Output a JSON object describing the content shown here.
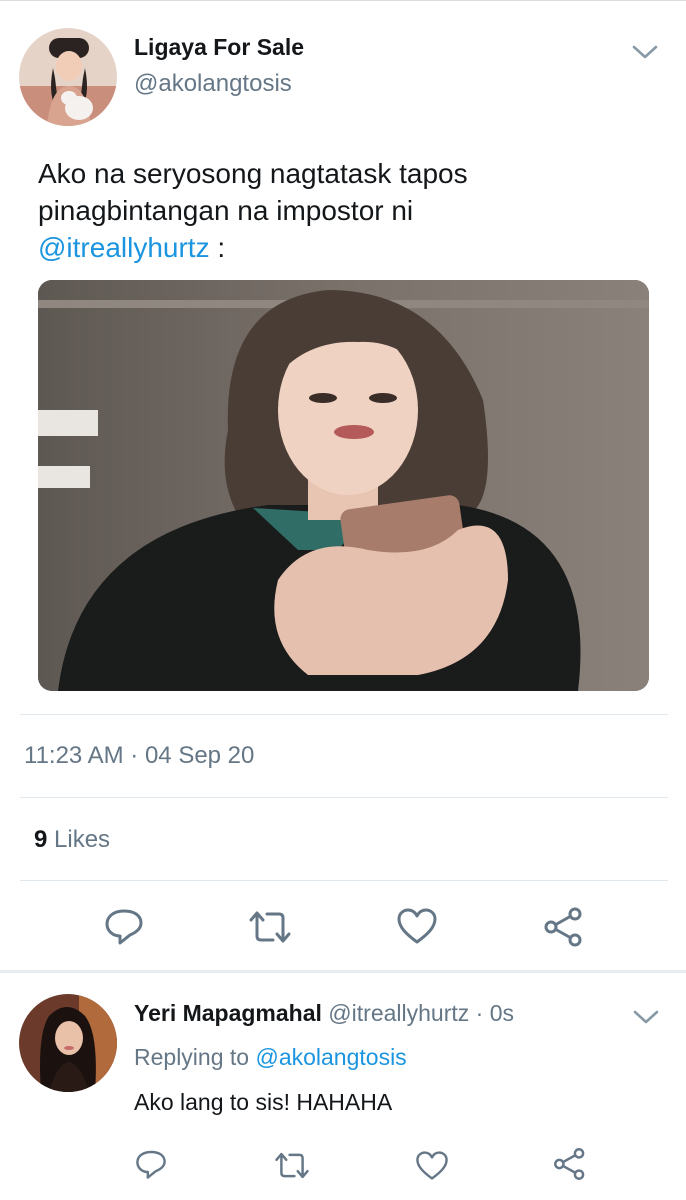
{
  "main_tweet": {
    "display_name": "Ligaya For Sale",
    "handle": "@akolangtosis",
    "text_line1": "Ako na seryosong nagtatask tapos",
    "text_line2": "pinagbintangan na impostor ni",
    "mention": "@itreallyhurtz",
    "text_suffix": " :",
    "timestamp": "11:23 AM · 04 Sep 20",
    "likes_count": "9",
    "likes_label": " Likes",
    "actions": [
      "reply-icon",
      "retweet-icon",
      "like-icon",
      "share-icon"
    ]
  },
  "reply": {
    "display_name": "Yeri Mapagmahal",
    "handle_time": " @itreallyhurtz · 0s",
    "replying_prefix": "Replying to ",
    "replying_to": "@akolangtosis",
    "text": "Ako lang to sis! HAHAHA",
    "actions": [
      "reply-icon",
      "retweet-icon",
      "like-icon",
      "share-icon"
    ]
  },
  "colors": {
    "text_primary": "#14171a",
    "text_secondary": "#657786",
    "link": "#1b95e0",
    "icon": "#657786",
    "divider": "#e1e8ed"
  }
}
